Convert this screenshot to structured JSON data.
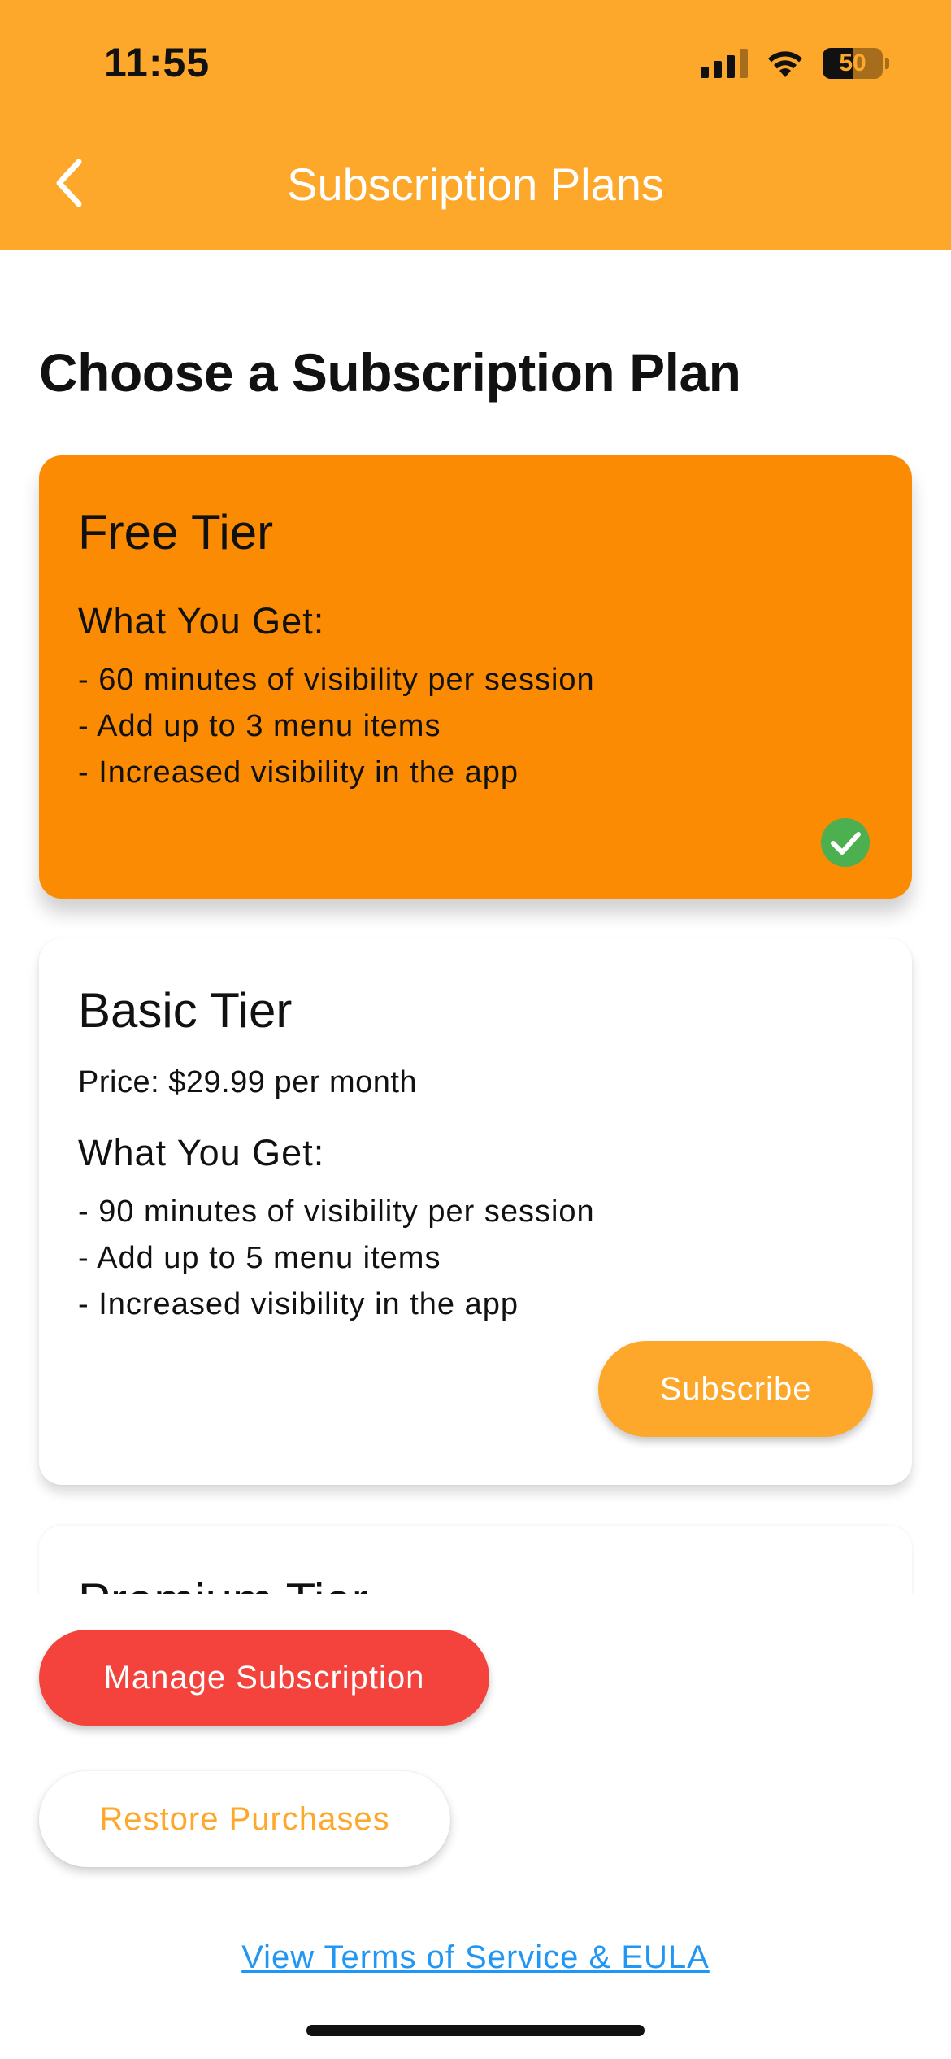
{
  "status_bar": {
    "time": "11:55",
    "battery_level": "50",
    "icons": [
      "cellular-signal-icon",
      "wifi-icon",
      "battery-icon"
    ]
  },
  "nav": {
    "back_icon": "chevron-left-icon",
    "title": "Subscription Plans"
  },
  "page": {
    "heading": "Choose a Subscription Plan"
  },
  "tiers": [
    {
      "title": "Free Tier",
      "selected": true,
      "section_label": "What You Get:",
      "features": [
        "- 60 minutes of visibility per session",
        "- Add up to 3 menu items",
        "- Increased visibility in the app"
      ],
      "selected_icon": "check-circle-icon"
    },
    {
      "title": "Basic Tier",
      "selected": false,
      "price": "Price: $29.99 per month",
      "section_label": "What You Get:",
      "features": [
        "- 90 minutes of visibility per session",
        "- Add up to 5 menu items",
        "- Increased visibility in the app"
      ],
      "action_label": "Subscribe"
    },
    {
      "title": "Premium Tier",
      "selected": false
    }
  ],
  "actions": {
    "manage_label": "Manage Subscription",
    "restore_label": "Restore Purchases",
    "terms_label": "View Terms of Service & EULA"
  },
  "colors": {
    "header": "#FEA82B",
    "selected_card": "#FB8B03",
    "accent": "#FEA82B",
    "manage": "#F4433C",
    "link": "#2196F3",
    "check": "#4CAF50"
  }
}
